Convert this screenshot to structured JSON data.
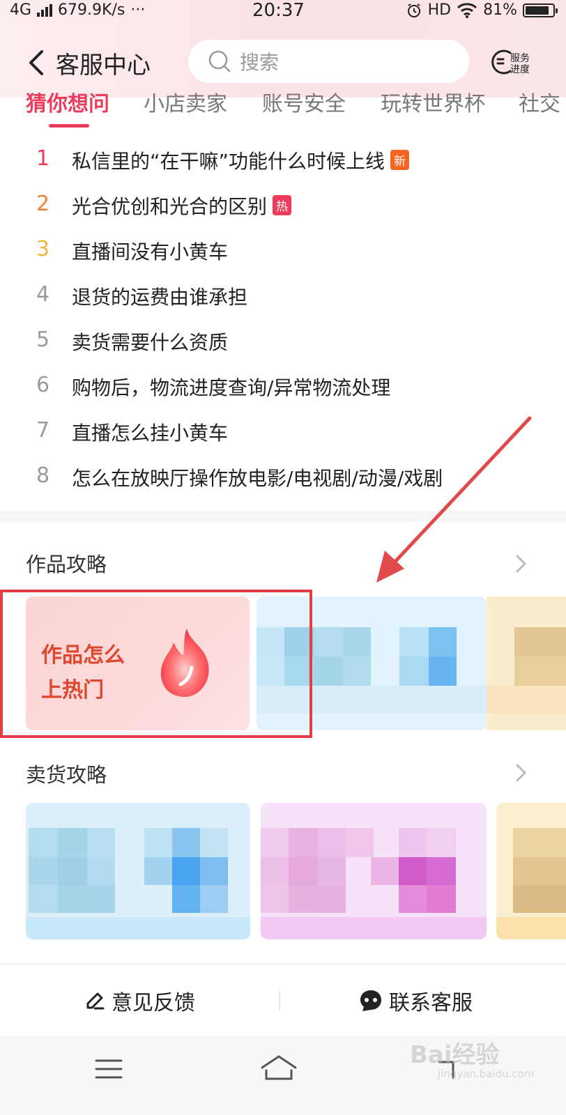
{
  "status_bar": {
    "network": "4G",
    "speed": "679.9K/s",
    "more": "···",
    "time": "20:37",
    "hd": "HD",
    "battery": "81%"
  },
  "header": {
    "title": "客服中心",
    "search_placeholder": "搜索",
    "service_progress_label_1": "服务",
    "service_progress_label_2": "进度"
  },
  "tabs": [
    {
      "label": "猜你想问",
      "active": true
    },
    {
      "label": "小店卖家",
      "active": false
    },
    {
      "label": "账号安全",
      "active": false
    },
    {
      "label": "玩转世界杯",
      "active": false
    },
    {
      "label": "社交",
      "active": false
    }
  ],
  "questions": [
    {
      "num": "1",
      "text": "私信里的“在干嘛”功能什么时候上线",
      "badge": "新",
      "num_color": "#ef3b5b"
    },
    {
      "num": "2",
      "text": "光合优创和光合的区别",
      "badge": "热",
      "num_color": "#f0813b"
    },
    {
      "num": "3",
      "text": "直播间没有小黄车",
      "badge": "",
      "num_color": "#f2b53c"
    },
    {
      "num": "4",
      "text": "退货的运费由谁承担",
      "badge": "",
      "num_color": "#9a9a9a"
    },
    {
      "num": "5",
      "text": "卖货需要什么资质",
      "badge": "",
      "num_color": "#9a9a9a"
    },
    {
      "num": "6",
      "text": "购物后，物流进度查询/异常物流处理",
      "badge": "",
      "num_color": "#9a9a9a"
    },
    {
      "num": "7",
      "text": "直播怎么挂小黄车",
      "badge": "",
      "num_color": "#9a9a9a"
    },
    {
      "num": "8",
      "text": "怎么在放映厅操作放电影/电视剧/动漫/戏剧",
      "badge": "",
      "num_color": "#9a9a9a"
    }
  ],
  "badge_colors": {
    "新": "#f5651f",
    "热": "#ef3b5b"
  },
  "sections": {
    "works_guide": {
      "title": "作品攻略",
      "card_text_1": "作品怎么",
      "card_text_2": "上热门"
    },
    "selling_guide": {
      "title": "卖货攻略"
    }
  },
  "bottom_bar": {
    "feedback": "意见反馈",
    "contact": "联系客服"
  },
  "watermark": {
    "text": "Bai经验",
    "sub": "jingyan.baidu.com"
  },
  "colors": {
    "accent": "#ef3b5b",
    "highlight_box": "#e53d45",
    "arrow": "#e04a4a"
  }
}
